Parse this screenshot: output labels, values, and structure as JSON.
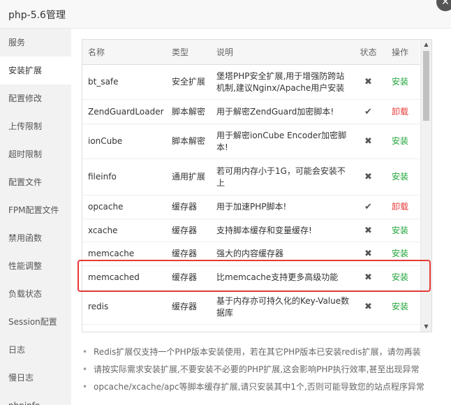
{
  "window": {
    "title": "php-5.6管理",
    "close_glyph": "✕"
  },
  "sidebar": {
    "items": [
      {
        "label": "服务"
      },
      {
        "label": "安装扩展"
      },
      {
        "label": "配置修改"
      },
      {
        "label": "上传限制"
      },
      {
        "label": "超时限制"
      },
      {
        "label": "配置文件"
      },
      {
        "label": "FPM配置文件"
      },
      {
        "label": "禁用函数"
      },
      {
        "label": "性能调整"
      },
      {
        "label": "负载状态"
      },
      {
        "label": "Session配置"
      },
      {
        "label": "日志"
      },
      {
        "label": "慢日志"
      },
      {
        "label": "phpinfo"
      }
    ],
    "active_index": 1
  },
  "table": {
    "headers": {
      "name": "名称",
      "type": "类型",
      "desc": "说明",
      "status": "状态",
      "action": "操作"
    },
    "rows": [
      {
        "name": "bt_safe",
        "type": "安全扩展",
        "desc": "堡塔PHP安全扩展,用于增强防跨站机制,建议Nginx/Apache用户安装",
        "status": "✖",
        "action": "安装",
        "action_kind": "install"
      },
      {
        "name": "ZendGuardLoader",
        "type": "脚本解密",
        "desc": "用于解密ZendGuard加密脚本!",
        "status": "✔",
        "action": "卸载",
        "action_kind": "uninstall"
      },
      {
        "name": "ionCube",
        "type": "脚本解密",
        "desc": "用于解密ionCube Encoder加密脚本!",
        "status": "✖",
        "action": "安装",
        "action_kind": "install"
      },
      {
        "name": "fileinfo",
        "type": "通用扩展",
        "desc": "若可用内存小于1G，可能会安装不上",
        "status": "✖",
        "action": "安装",
        "action_kind": "install"
      },
      {
        "name": "opcache",
        "type": "缓存器",
        "desc": "用于加速PHP脚本!",
        "status": "✔",
        "action": "卸载",
        "action_kind": "uninstall"
      },
      {
        "name": "xcache",
        "type": "缓存器",
        "desc": "支持脚本缓存和变量缓存!",
        "status": "✖",
        "action": "安装",
        "action_kind": "install"
      },
      {
        "name": "memcache",
        "type": "缓存器",
        "desc": "强大的内容缓存器",
        "status": "✖",
        "action": "安装",
        "action_kind": "install"
      },
      {
        "name": "memcached",
        "type": "缓存器",
        "desc": "比memcache支持更多高级功能",
        "status": "✖",
        "action": "安装",
        "action_kind": "install"
      },
      {
        "name": "redis",
        "type": "缓存器",
        "desc": "基于内存亦可持久化的Key-Value数据库",
        "status": "✖",
        "action": "安装",
        "action_kind": "install"
      }
    ]
  },
  "scrollbar": {
    "up_glyph": "▲",
    "down_glyph": "▼"
  },
  "notes": [
    "Redis扩展仅支持一个PHP版本安装使用，若在其它PHP版本已安装redis扩展，请勿再装",
    "请按实际需求安装扩展,不要安装不必要的PHP扩展,这会影响PHP执行效率,甚至出现异常",
    "opcache/xcache/apc等脚本缓存扩展,请只安装其中1个,否则可能导致您的站点程序异常"
  ],
  "colors": {
    "install": "#20a53a",
    "uninstall": "#e53b3b",
    "highlight_border": "#e53935"
  }
}
